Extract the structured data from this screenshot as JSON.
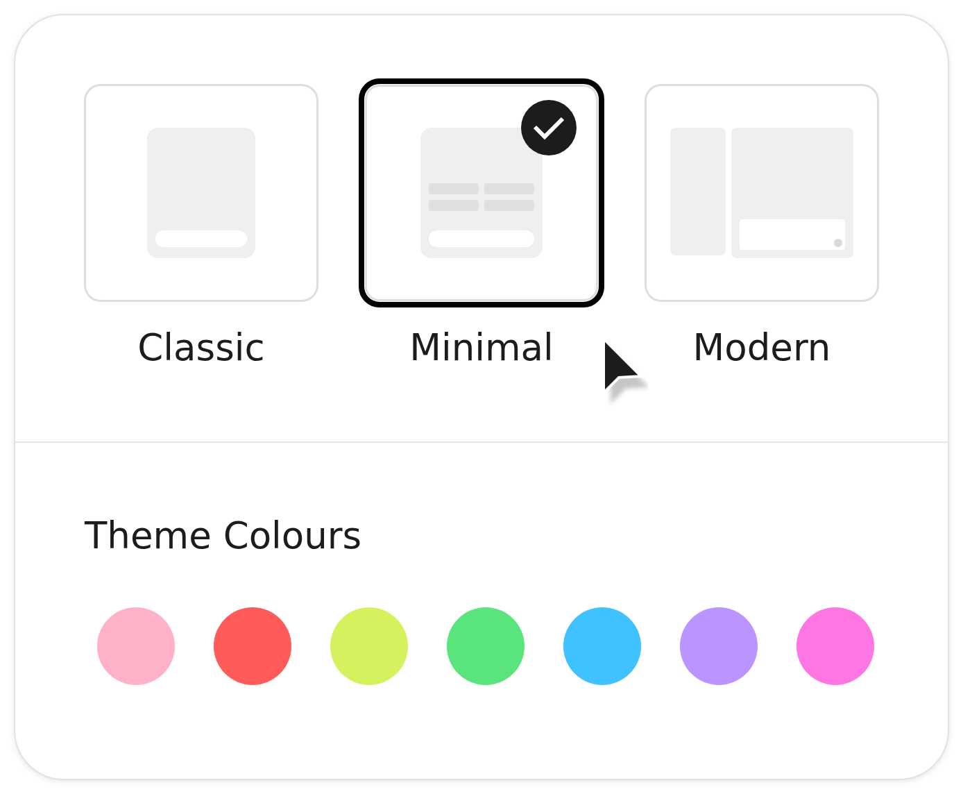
{
  "layouts": [
    {
      "label": "Classic",
      "kind": "classic",
      "selected": false
    },
    {
      "label": "Minimal",
      "kind": "minimal",
      "selected": true
    },
    {
      "label": "Modern",
      "kind": "modern",
      "selected": false
    }
  ],
  "theme_colours": {
    "title": "Theme Colours",
    "swatches": [
      {
        "color": "#ffb1c8",
        "selected": false
      },
      {
        "color": "#ff5b5b",
        "selected": false
      },
      {
        "color": "#d3f25e",
        "selected": false
      },
      {
        "color": "#59e47e",
        "selected": false
      },
      {
        "color": "#3fc2ff",
        "selected": false
      },
      {
        "color": "#ba94ff",
        "selected": false
      },
      {
        "color": "#ff76e3",
        "selected": false
      }
    ]
  }
}
